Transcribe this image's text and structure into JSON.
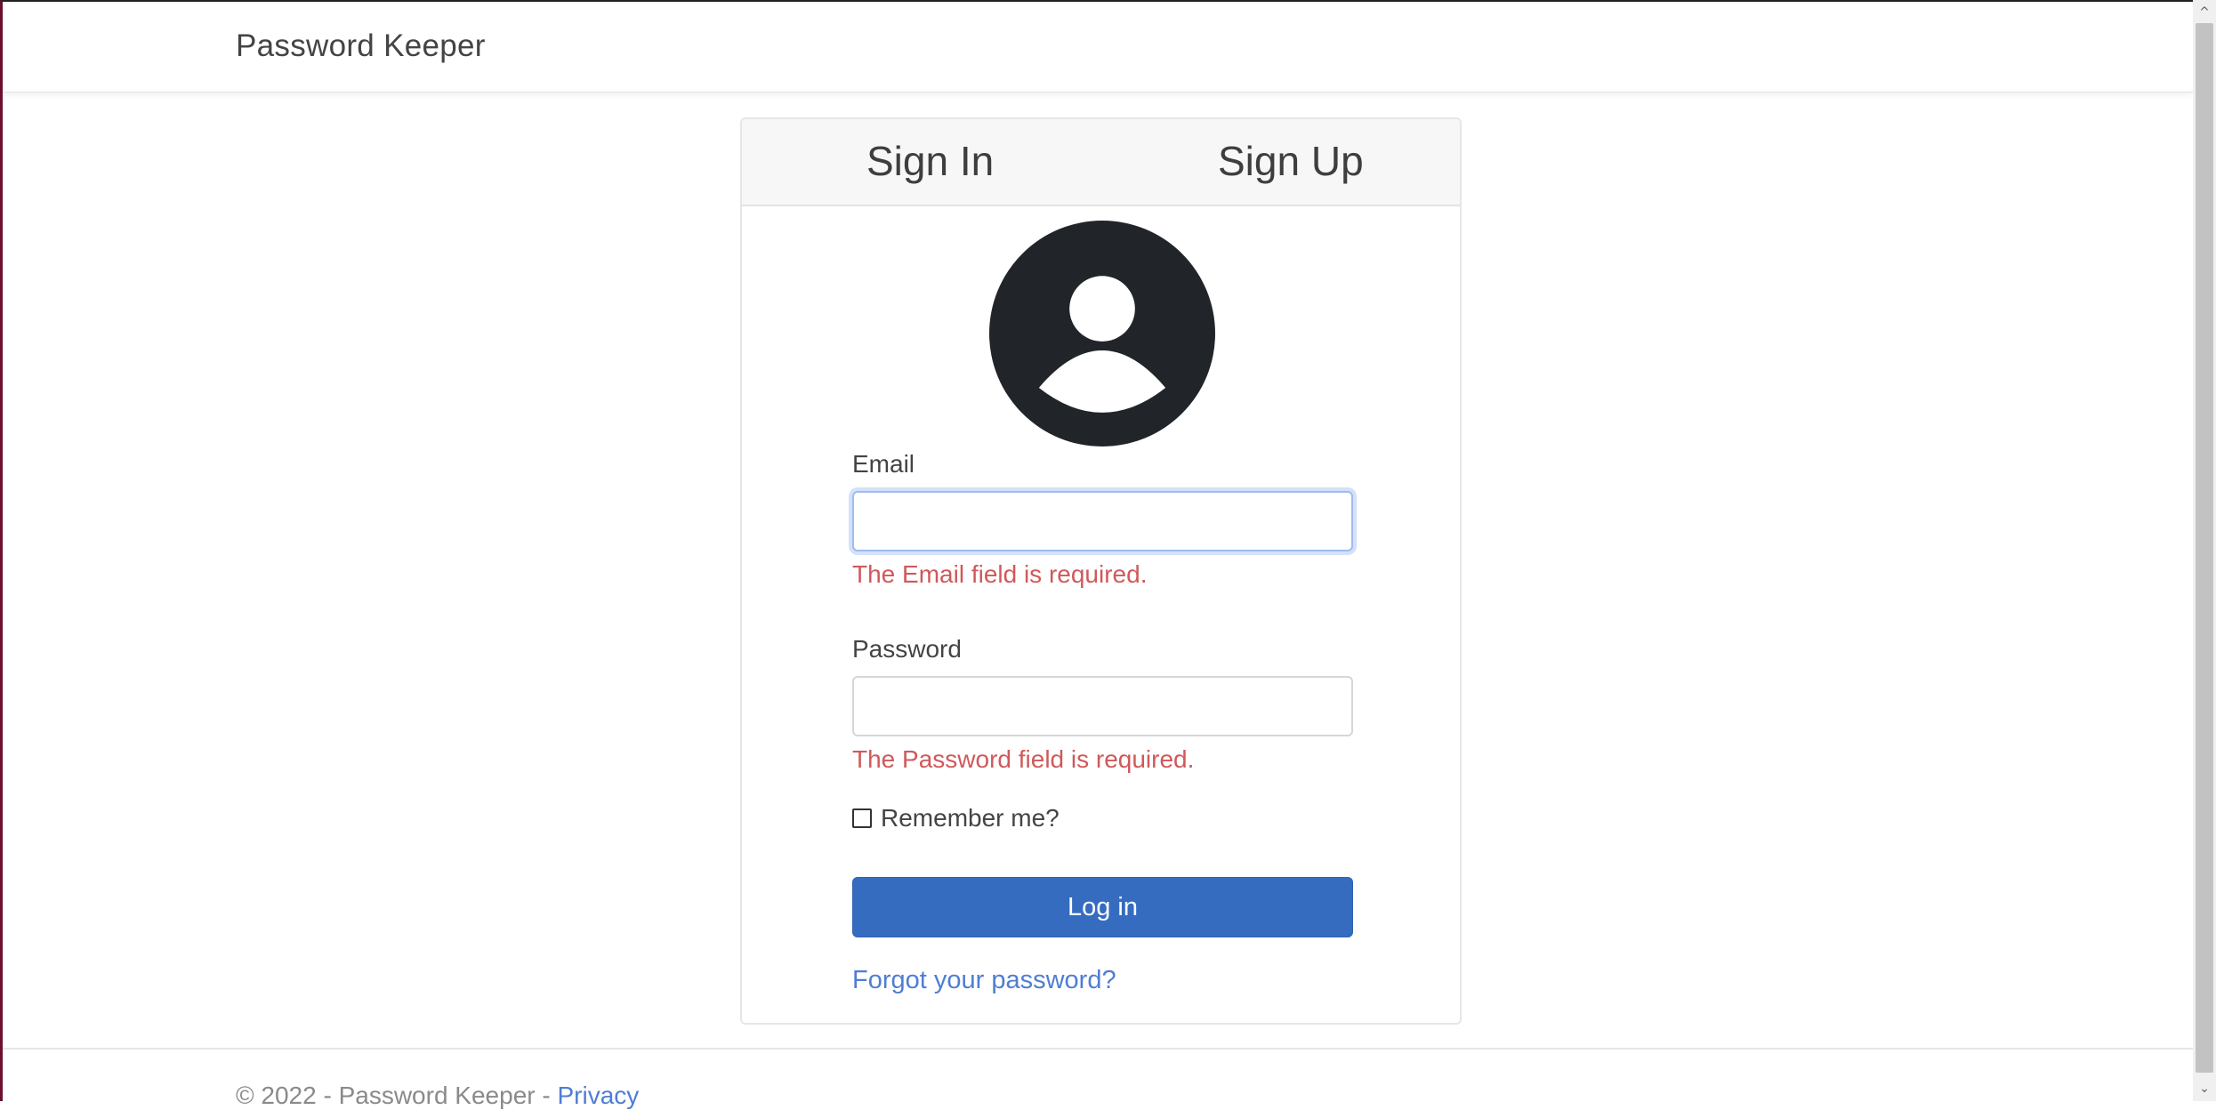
{
  "navbar": {
    "brand": "Password Keeper"
  },
  "tabs": {
    "sign_in": "Sign In",
    "sign_up": "Sign Up"
  },
  "form": {
    "email_label": "Email",
    "email_value": "",
    "email_error": "The Email field is required.",
    "password_label": "Password",
    "password_value": "",
    "password_error": "The Password field is required.",
    "remember_label": "Remember me?",
    "login_label": "Log in",
    "forgot_label": "Forgot your password?"
  },
  "footer": {
    "copyright": "© 2022 - Password Keeper - ",
    "privacy_label": "Privacy"
  },
  "icons": {
    "avatar": "user-circle-icon",
    "scroll_up": "chevron-up-icon",
    "scroll_down": "chevron-down-icon"
  },
  "colors": {
    "primary_button": "#356cc0",
    "error_text": "#d0595a",
    "link": "#4f7ed2",
    "avatar": "#212529"
  }
}
